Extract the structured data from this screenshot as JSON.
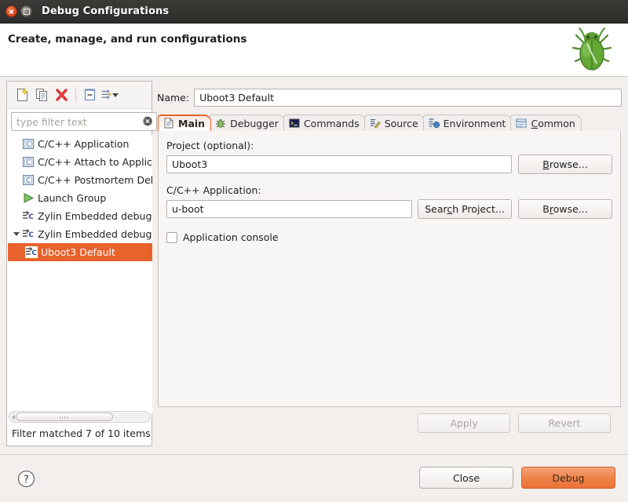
{
  "window": {
    "title": "Debug Configurations",
    "close_tooltip": "Close",
    "maximize_tooltip": "Maximize"
  },
  "banner": {
    "headline": "Create, manage, and run configurations",
    "icon": "green-bug-icon"
  },
  "tree_toolbar": {
    "buttons": [
      {
        "name": "new-launch-configuration",
        "icon": "new-document-icon"
      },
      {
        "name": "duplicate-launch-configuration",
        "icon": "copy-document-icon"
      },
      {
        "name": "delete-launch-configuration",
        "icon": "delete-red-x-icon"
      },
      {
        "name": "collapse-all",
        "icon": "collapse-all-icon"
      },
      {
        "name": "filter-launch-configurations",
        "icon": "filter-arrows-icon"
      }
    ],
    "dropdown_caret": "▾"
  },
  "filter": {
    "placeholder": "type filter text",
    "value": "",
    "clear_icon": "clear-circle-x-icon",
    "status": "Filter matched 7 of 10 items"
  },
  "tree": {
    "items": [
      {
        "label": "C/C++ Application",
        "icon": "c-app-icon",
        "indent": 0,
        "expanded": null,
        "selected": false
      },
      {
        "label": "C/C++ Attach to Application",
        "icon": "c-app-icon",
        "indent": 0,
        "expanded": null,
        "selected": false
      },
      {
        "label": "C/C++ Postmortem Debugger",
        "icon": "c-app-icon",
        "indent": 0,
        "expanded": null,
        "selected": false
      },
      {
        "label": "Launch Group",
        "icon": "green-play-icon",
        "indent": 0,
        "expanded": null,
        "selected": false
      },
      {
        "label": "Zylin Embedded debug (Cygwin)",
        "icon": "zylin-debug-icon",
        "indent": 0,
        "expanded": null,
        "selected": false
      },
      {
        "label": "Zylin Embedded debug (Native)",
        "icon": "zylin-debug-icon",
        "indent": 0,
        "expanded": true,
        "selected": false
      },
      {
        "label": "Uboot3 Default",
        "icon": "zylin-debug-icon",
        "indent": 1,
        "expanded": null,
        "selected": true
      }
    ],
    "selection_color": "#e8622c"
  },
  "config": {
    "name_label": "Name:",
    "name_value": "Uboot3 Default",
    "tabs": [
      {
        "label": "Main",
        "icon": "document-icon",
        "active": true,
        "mnemonic": ""
      },
      {
        "label": "Debugger",
        "icon": "debugger-bug-icon",
        "active": false,
        "mnemonic": ""
      },
      {
        "label": "Commands",
        "icon": "terminal-icon",
        "active": false,
        "mnemonic": ""
      },
      {
        "label": "Source",
        "icon": "source-pencil-icon",
        "active": false,
        "mnemonic": ""
      },
      {
        "label": "Environment",
        "icon": "environment-icon",
        "active": false,
        "mnemonic": ""
      },
      {
        "label": "Common",
        "icon": "common-list-icon",
        "active": false,
        "mnemonic": "C"
      }
    ],
    "main_tab": {
      "project_label": "Project (optional):",
      "project_value": "Uboot3",
      "project_browse_label": "Browse...",
      "project_browse_mnemonic": "B",
      "application_label": "C/C++ Application:",
      "application_value": "u-boot",
      "search_project_label": "Search Project...",
      "search_project_mnemonic": "c",
      "application_browse_label": "Browse...",
      "application_browse_mnemonic": "r",
      "console_checkbox_label": "Application console",
      "console_checked": false
    },
    "apply_label": "Apply",
    "apply_enabled": false,
    "revert_label": "Revert",
    "revert_enabled": false
  },
  "footer": {
    "help_icon": "help-question-icon",
    "close_label": "Close",
    "debug_label": "Debug",
    "debug_accent": "#ec7238"
  }
}
